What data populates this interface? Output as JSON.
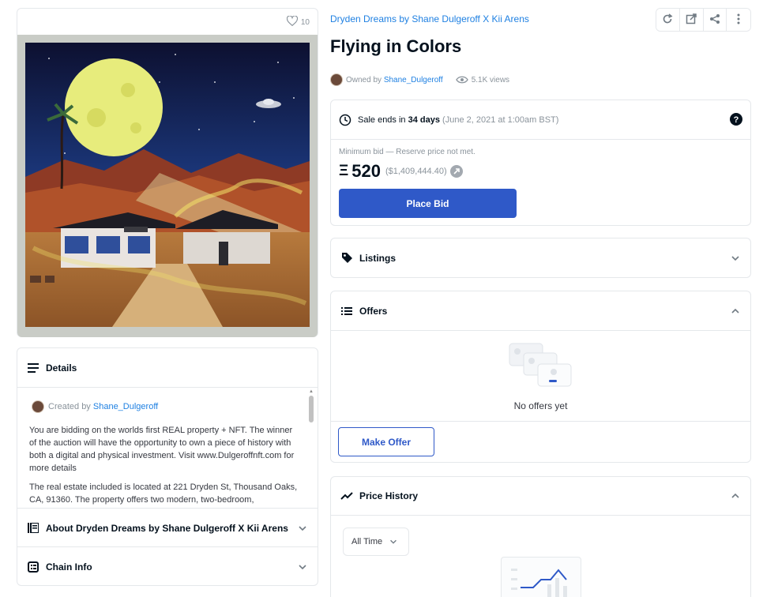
{
  "image_card": {
    "likes": "10"
  },
  "details": {
    "heading": "Details",
    "created_by_prefix": "Created by",
    "creator": "Shane_Dulgeroff",
    "paragraphs": [
      "You are bidding on the worlds first REAL property + NFT. The winner of the auction will have the opportunity to own a piece of history with both a digital and physical investment. Visit www.Dulgeroffnft.com for more details",
      "The real estate included is located at 221 Dryden St, Thousand Oaks, CA, 91360. The property offers two modern, two-bedroom,"
    ]
  },
  "about": {
    "heading": "About Dryden Dreams by Shane Dulgeroff X Kii Arens"
  },
  "chain": {
    "heading": "Chain Info"
  },
  "collection": {
    "name": "Dryden Dreams by Shane Dulgeroff X Kii Arens"
  },
  "item": {
    "title": "Flying in Colors",
    "owned_by_prefix": "Owned by",
    "owner": "Shane_Dulgeroff",
    "views": "5.1K views"
  },
  "sale": {
    "ends_prefix": "Sale ends in",
    "ends_bold": "34 days",
    "ends_date": "(June 2, 2021 at 1:00am BST)",
    "min_bid_label": "Minimum bid — Reserve price not met.",
    "eth_symbol": "Ξ",
    "price": "520",
    "usd": "($1,409,444.40)",
    "place_bid": "Place Bid"
  },
  "listings": {
    "heading": "Listings"
  },
  "offers": {
    "heading": "Offers",
    "empty": "No offers yet",
    "make_offer": "Make Offer"
  },
  "price_history": {
    "heading": "Price History",
    "range": "All Time"
  },
  "colors": {
    "accent": "#2081e2",
    "primary_button": "#2f59c8",
    "border": "#e5e8eb"
  }
}
